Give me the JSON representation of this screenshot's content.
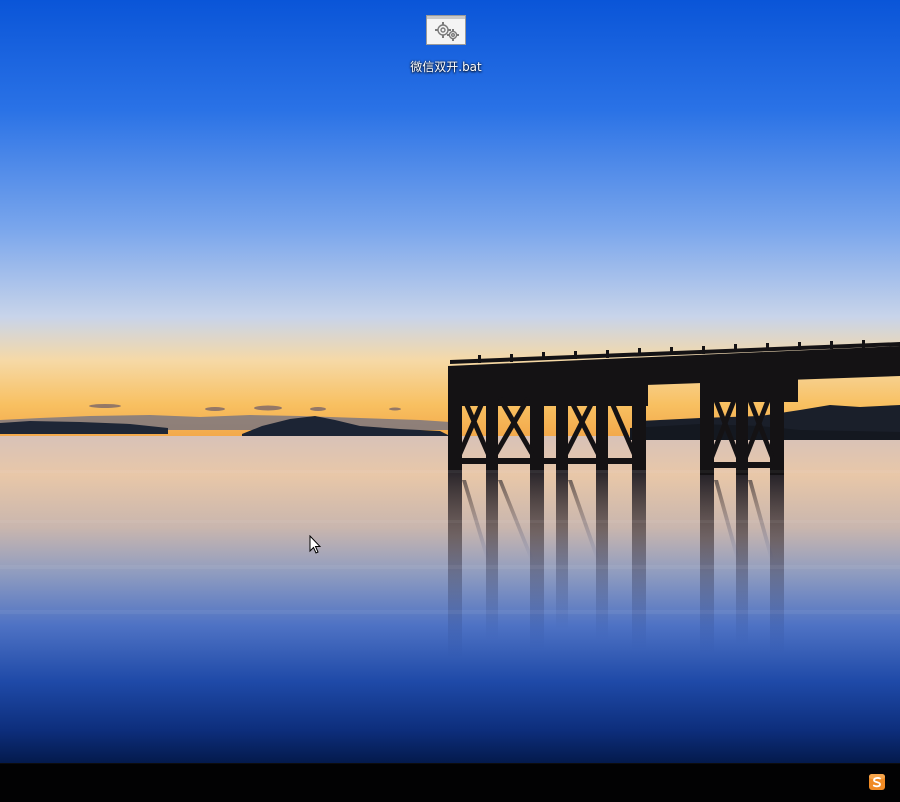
{
  "desktop": {
    "icons": [
      {
        "label": "微信双开.bat",
        "icon": "batch-file-gears-icon"
      }
    ]
  },
  "taskbar": {
    "tray": [
      {
        "icon": "sogou-input-method-icon",
        "color": "#f08a24"
      }
    ]
  },
  "colors": {
    "sky_top": "#0a55d8",
    "horizon_glow": "#f8c46a",
    "water_deep": "#0a2a7a",
    "taskbar": "#020203"
  }
}
